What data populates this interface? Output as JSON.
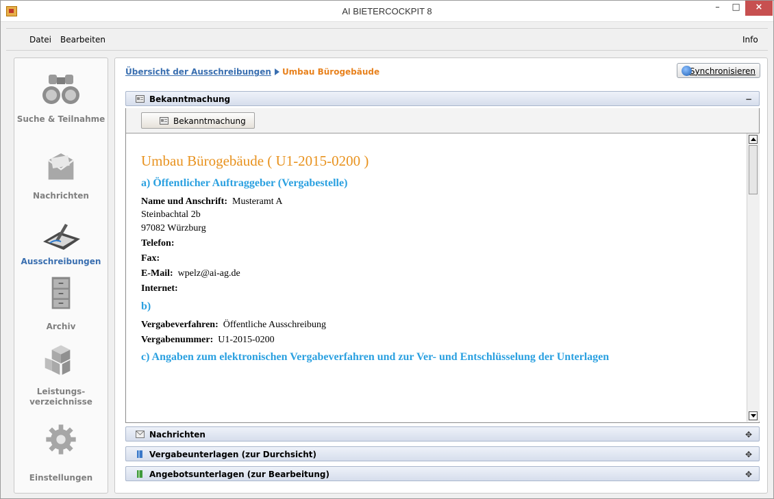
{
  "window": {
    "title": "AI BIETERCOCKPIT 8",
    "minimize": "–",
    "maximize": "□",
    "close": "×"
  },
  "menu": {
    "datei": "Datei",
    "bearbeiten": "Bearbeiten",
    "info": "Info"
  },
  "sidebar": {
    "items": [
      {
        "label": "Suche & Teilnahme",
        "icon": "binoculars-icon"
      },
      {
        "label": "Nachrichten",
        "icon": "mailbox-icon"
      },
      {
        "label": "Ausschreibungen",
        "icon": "tablet-pen-icon",
        "active": true
      },
      {
        "label": "Archiv",
        "icon": "filing-cabinet-icon"
      },
      {
        "label": "Leistungs- verzeichnisse",
        "icon": "boxes-icon"
      },
      {
        "label": "Einstellungen",
        "icon": "gear-icon"
      }
    ]
  },
  "breadcrumb": {
    "parent": "Übersicht der Ausschreibungen",
    "current": "Umbau Bürogebäude"
  },
  "sync_button": "Synchronisieren",
  "sections": {
    "bekanntmachung": {
      "label": "Bekanntmachung",
      "toggle": "−",
      "button": "Bekanntmachung"
    },
    "nachrichten": {
      "label": "Nachrichten",
      "toggle": "✥"
    },
    "vergabeunterlagen": {
      "label": "Vergabeunterlagen (zur Durchsicht)",
      "toggle": "✥"
    },
    "angebotsunterlagen": {
      "label": "Angebotsunterlagen (zur Bearbeitung)",
      "toggle": "✥"
    }
  },
  "document": {
    "title": "Umbau Bürogebäude  ( U1-2015-0200 )",
    "section_a": "a) Öffentlicher Auftraggeber (Vergabestelle)",
    "name_label": "Name und Anschrift:",
    "name_value": "Musteramt A",
    "street": "Steinbachtal 2b",
    "city": "97082 Würzburg",
    "telefon_label": "Telefon:",
    "fax_label": "Fax:",
    "email_label": "E-Mail:",
    "email_value": "wpelz@ai-ag.de",
    "internet_label": "Internet:",
    "section_b": "b)",
    "verfahren_label": "Vergabeverfahren:",
    "verfahren_value": "Öffentliche Ausschreibung",
    "nummer_label": "Vergabenummer:",
    "nummer_value": "U1-2015-0200",
    "section_c": "c) Angaben zum elektronischen Vergabeverfahren und zur Ver- und Entschlüsselung der Unterlagen"
  },
  "colors": {
    "accent_blue": "#3a6fb0",
    "accent_orange": "#e8821e",
    "heading_blue": "#2aa0e0"
  }
}
